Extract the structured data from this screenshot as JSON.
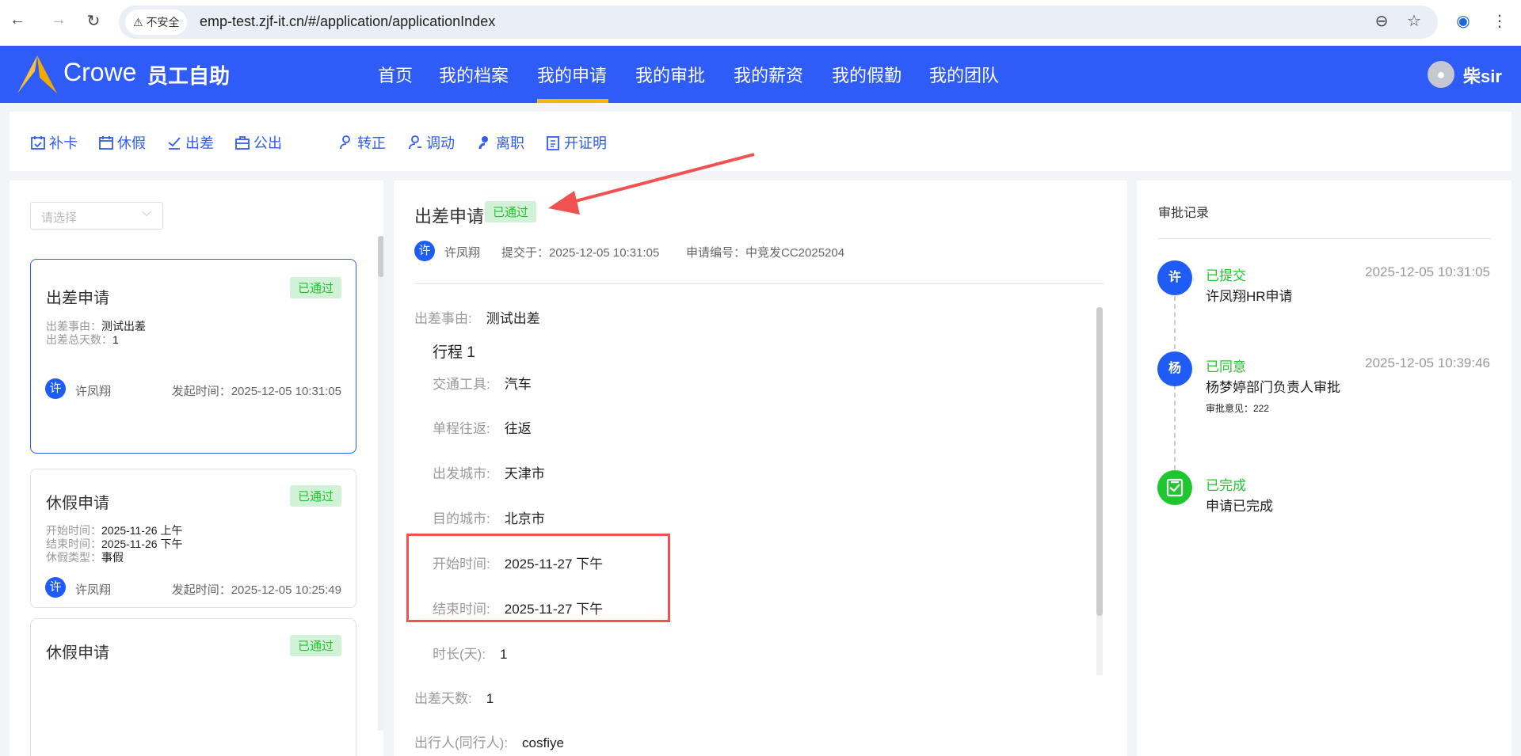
{
  "browser": {
    "security_label": "不安全",
    "url": "emp-test.zjf-it.cn/#/application/applicationIndex"
  },
  "header": {
    "brand": "Crowe",
    "app_name": "员工自助",
    "nav": [
      "首页",
      "我的档案",
      "我的申请",
      "我的审批",
      "我的薪资",
      "我的假勤",
      "我的团队"
    ],
    "active_nav": "我的申请",
    "user": "柴sir"
  },
  "toolbar": [
    {
      "label": "补卡",
      "icon": "calendar-check-icon"
    },
    {
      "label": "休假",
      "icon": "calendar-leave-icon"
    },
    {
      "label": "出差",
      "icon": "travel-icon"
    },
    {
      "label": "公出",
      "icon": "briefcase-icon"
    },
    {
      "label": "转正",
      "icon": "user-check-icon"
    },
    {
      "label": "调动",
      "icon": "user-transfer-icon"
    },
    {
      "label": "离职",
      "icon": "user-leave-icon"
    },
    {
      "label": "开证明",
      "icon": "clipboard-icon"
    }
  ],
  "list": {
    "select_placeholder": "请选择",
    "cards": [
      {
        "title": "出差申请",
        "status": "已通过",
        "lines": [
          [
            "出差事由：",
            "测试出差"
          ],
          [
            "出差总天数：",
            "1"
          ]
        ],
        "avatar": "许",
        "name": "许凤翔",
        "time_label": "发起时间：",
        "time": "2025-12-05 10:31:05"
      },
      {
        "title": "休假申请",
        "status": "已通过",
        "lines": [
          [
            "开始时间：",
            "2025-11-26 上午"
          ],
          [
            "结束时间：",
            "2025-11-26 下午"
          ],
          [
            "休假类型：",
            "事假"
          ]
        ],
        "avatar": "许",
        "name": "许凤翔",
        "time_label": "发起时间：",
        "time": "2025-12-05 10:25:49"
      },
      {
        "title": "休假申请",
        "status": "已通过"
      }
    ]
  },
  "detail": {
    "title": "出差申请",
    "status": "已通过",
    "avatar": "许",
    "name": "许凤翔",
    "submitted": "提交于：2025-12-05 10:31:05",
    "number": "申请编号：中竞发CC2025204",
    "reason_label": "出差事由:",
    "reason": "测试出差",
    "trip_title": "行程 1",
    "trip": [
      [
        "交通工具:",
        "汽车"
      ],
      [
        "单程往返:",
        "往返"
      ],
      [
        "出发城市:",
        "天津市"
      ],
      [
        "目的城市:",
        "北京市"
      ],
      [
        "开始时间:",
        "2025-11-27 下午"
      ],
      [
        "结束时间:",
        "2025-11-27 下午"
      ],
      [
        "时长(天):",
        "1"
      ]
    ],
    "days_label": "出差天数:",
    "days": "1",
    "partial_label": "出行人(同行人):",
    "partial_value": "cosfiye"
  },
  "approval": {
    "title": "审批记录",
    "items": [
      {
        "avatar": "许",
        "status": "已提交",
        "time": "2025-12-05 10:31:05",
        "desc": "许凤翔HR申请"
      },
      {
        "avatar": "杨",
        "status": "已同意",
        "time": "2025-12-05 10:39:46",
        "desc": "杨梦婷部门负责人审批",
        "comment": "审批意见：222"
      },
      {
        "status": "已完成",
        "desc": "申请已完成"
      }
    ]
  }
}
